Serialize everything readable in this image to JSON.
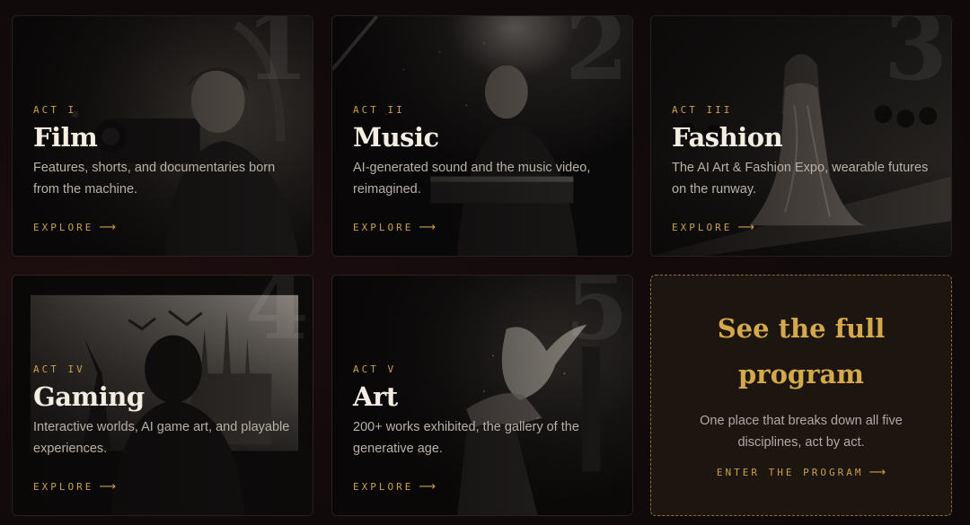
{
  "cards": [
    {
      "act": "ACT I",
      "title": "Film",
      "number": "1",
      "description": "Features, shorts, and documentaries born from the machine.",
      "cta": "EXPLORE"
    },
    {
      "act": "ACT II",
      "title": "Music",
      "number": "2",
      "description": "AI-generated sound and the music video, reimagined.",
      "cta": "EXPLORE"
    },
    {
      "act": "ACT III",
      "title": "Fashion",
      "number": "3",
      "description": "The AI Art & Fashion Expo, wearable futures on the runway.",
      "cta": "EXPLORE"
    },
    {
      "act": "ACT IV",
      "title": "Gaming",
      "number": "4",
      "description": "Interactive worlds, AI game art, and playable experiences.",
      "cta": "EXPLORE"
    },
    {
      "act": "ACT V",
      "title": "Art",
      "number": "5",
      "description": "200+ works exhibited, the gallery of the generative age.",
      "cta": "EXPLORE"
    }
  ],
  "program": {
    "title": "See the full program",
    "description": "One place that breaks down all five disciplines, act by act.",
    "cta": "ENTER THE PROGRAM"
  },
  "icons": {
    "arrow": "arrow-right-icon"
  },
  "colors": {
    "accent": "#c9a04a",
    "cta_title": "#d4a94c",
    "background": "#120a0b"
  }
}
